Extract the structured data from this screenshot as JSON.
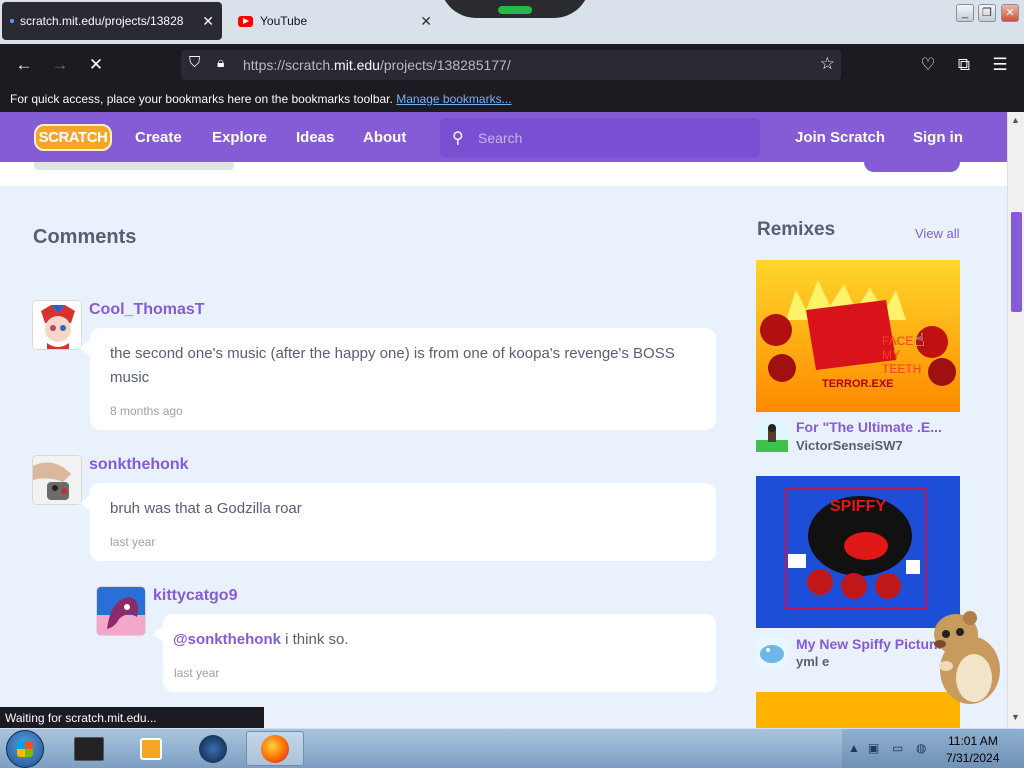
{
  "browser": {
    "tabs": [
      {
        "label": "scratch.mit.edu/projects/13828",
        "close": "✕"
      },
      {
        "label": "YouTube",
        "close": "✕"
      }
    ],
    "url_prefix": "https://scratch.",
    "url_domain": "mit.edu",
    "url_path": "/projects/138285177/",
    "bookmarks_text": "For quick access, place your bookmarks here on the bookmarks toolbar.",
    "bookmarks_link": "Manage bookmarks...",
    "status": "Waiting for scratch.mit.edu..."
  },
  "header": {
    "logo": "SCRATCH",
    "nav": [
      "Create",
      "Explore",
      "Ideas",
      "About"
    ],
    "search_placeholder": "Search",
    "join": "Join Scratch",
    "signin": "Sign in"
  },
  "comments": {
    "title": "Comments",
    "items": [
      {
        "user": "Cool_ThomasT",
        "text": "the second one's music (after the happy one) is from one of koopa's revenge's BOSS music",
        "date": "8 months ago"
      },
      {
        "user": "sonkthehonk",
        "text": "bruh was that a Godzilla roar",
        "date": "last year"
      },
      {
        "user": "kittycatgo9",
        "mention": "@sonkthehonk",
        "text": " i think so.",
        "date": "last year"
      }
    ]
  },
  "remixes": {
    "title": "Remixes",
    "view_all": "View all",
    "items": [
      {
        "name": "For \"The Ultimate .E...",
        "author": "VictorSenseiSW7",
        "thumb_text": [
          "FACE",
          "MY",
          "TEETH",
          "TERROR.EXE"
        ]
      },
      {
        "name": "My New Spiffy Pictur...",
        "author": "yml e",
        "thumb_text": [
          "SPIFFY"
        ]
      }
    ]
  },
  "taskbar": {
    "time": "11:01 AM",
    "date": "7/31/2024"
  }
}
